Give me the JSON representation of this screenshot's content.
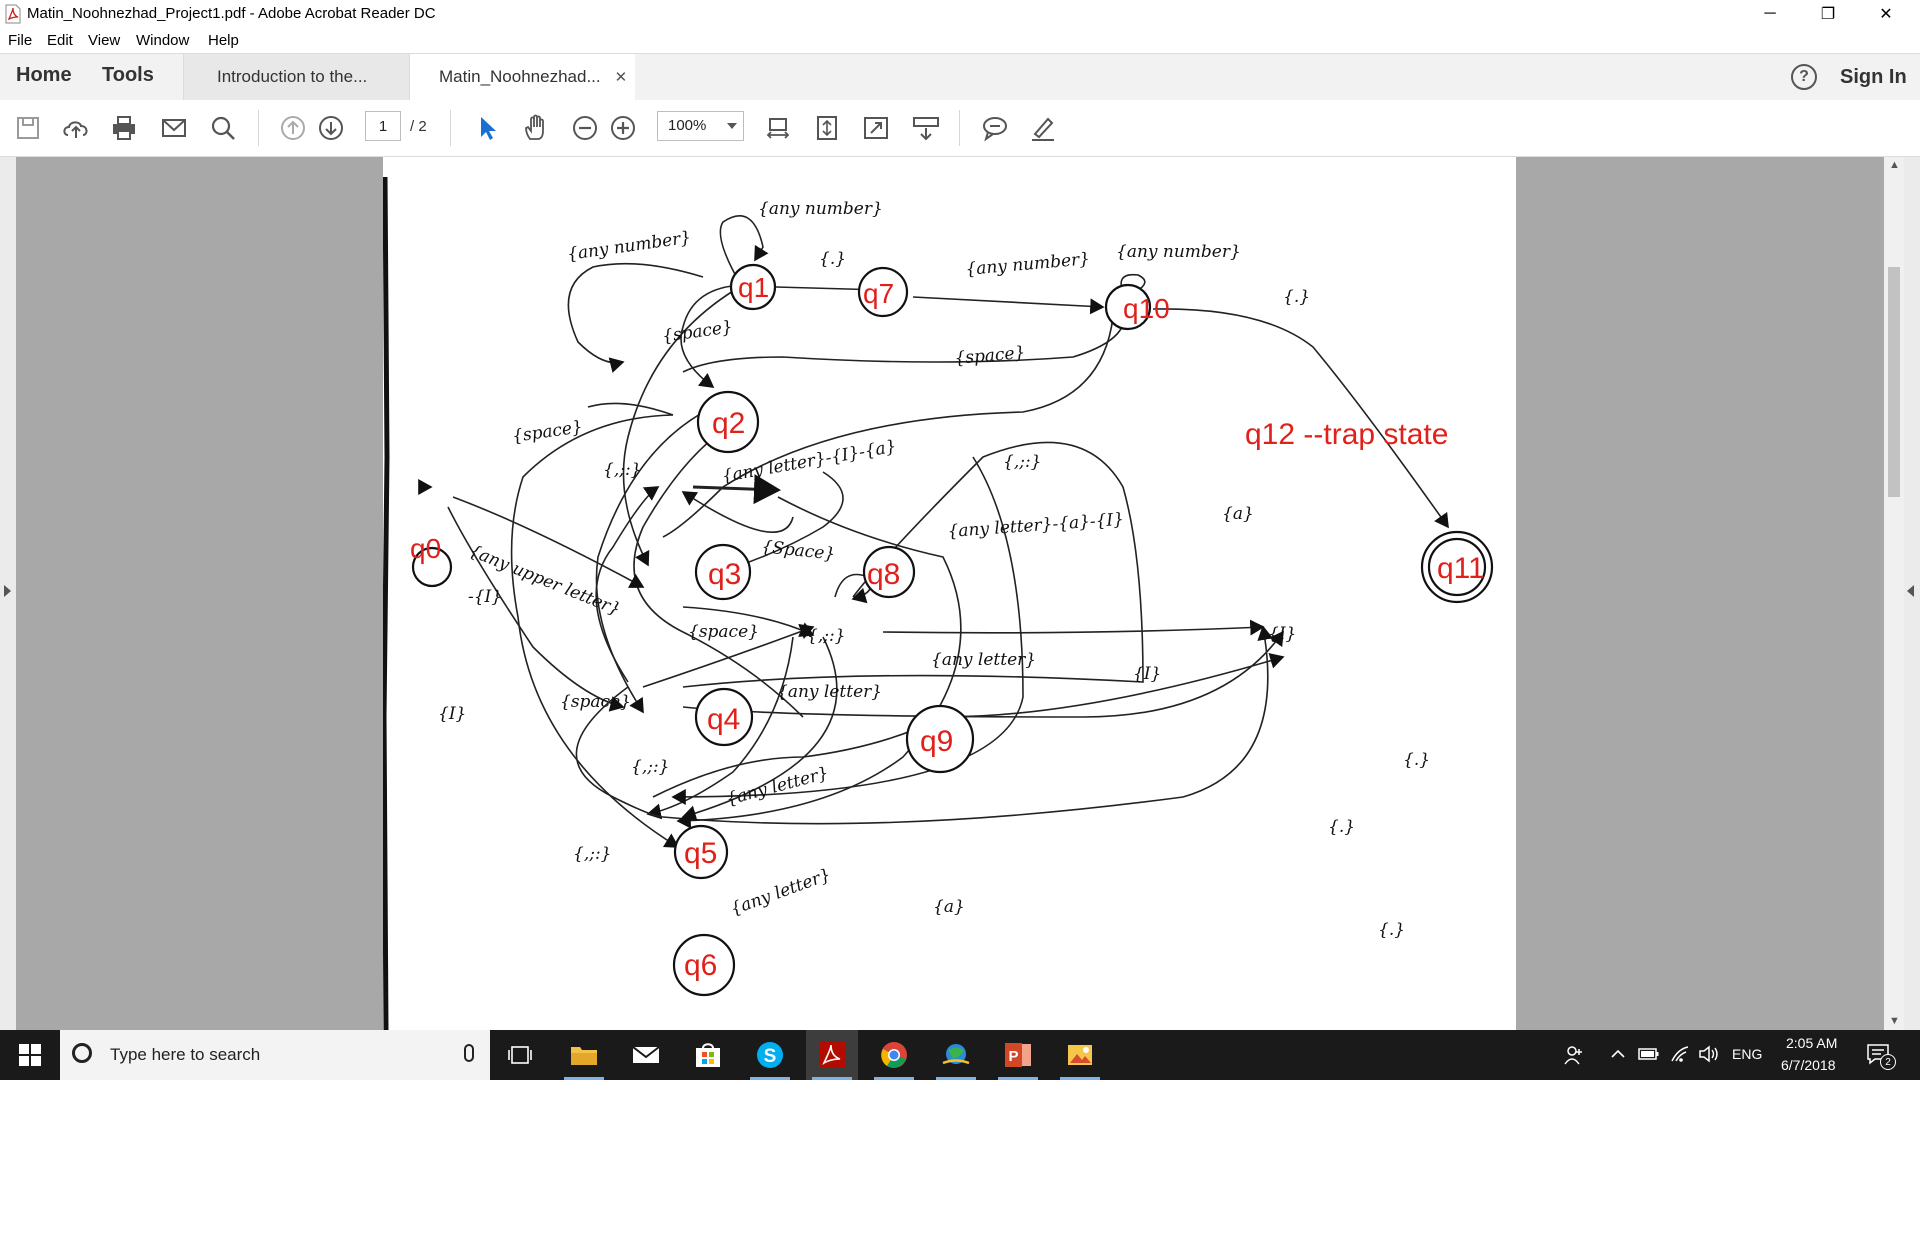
{
  "window": {
    "title": "Matin_Noohnezhad_Project1.pdf - Adobe Acrobat Reader DC",
    "minimize": "─",
    "restore": "❐",
    "close": "✕"
  },
  "menu": [
    "File",
    "Edit",
    "View",
    "Window",
    "Help"
  ],
  "tabs": {
    "home": "Home",
    "tools": "Tools",
    "doc1": "Introduction to the...",
    "doc2": "Matin_Noohnezhad...",
    "close": "✕",
    "help": "?",
    "signin": "Sign In"
  },
  "toolbar": {
    "page_current": "1",
    "page_total": "/ 2",
    "zoom": "100%"
  },
  "diagram": {
    "states": {
      "q0": "q0",
      "q1": "q1",
      "q2": "q2",
      "q3": "q3",
      "q4": "q4",
      "q5": "q5",
      "q6": "q6",
      "q7": "q7",
      "q8": "q8",
      "q9": "q9",
      "q10": "q10",
      "q11": "q11"
    },
    "trap_note": "q12 --trap state",
    "labels": {
      "l1": "{any number}",
      "l2": "{any number}",
      "l3": "{.}",
      "l4": "{any number}",
      "l5": "{any number}",
      "l6": "{.}",
      "l7": "{space}",
      "l8": "{space}",
      "l9": "{space}",
      "l10": "{,;:}",
      "l11": "{any letter}-{I}-{a}",
      "l12": "{,;:}",
      "l13": "{a}",
      "l14": "{any upper letter}",
      "l15": "-{I}",
      "l16": "{Space}",
      "l17": "{any letter}-{a}-{I}",
      "l18": "{I}",
      "l19": "{space}",
      "l20": "{,;:}",
      "l21": "{I}",
      "l22": "{any letter}",
      "l23": "{I}",
      "l24": "{space}",
      "l25": "{any letter}",
      "l26": "{.}",
      "l27": "{,;:}",
      "l28": "{any letter}",
      "l29": "{,;:}",
      "l30": "{.}",
      "l31": "{any letter}",
      "l32": "{a}",
      "l33": "{.}"
    }
  },
  "taskbar": {
    "search_placeholder": "Type here to search",
    "lang": "ENG",
    "time": "2:05 AM",
    "date": "6/7/2018",
    "notif_count": "2"
  }
}
